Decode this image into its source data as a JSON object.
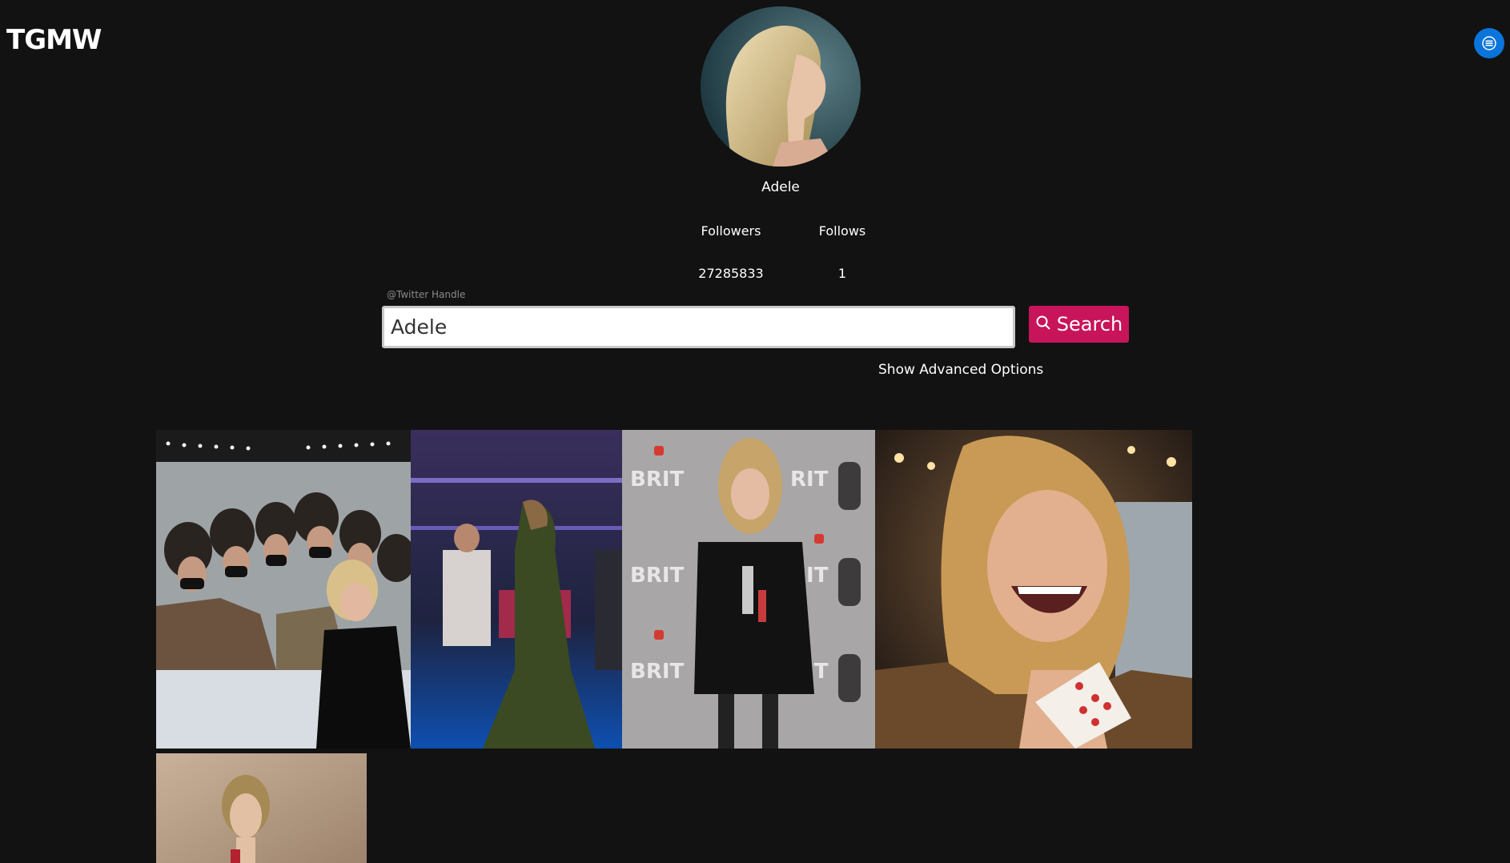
{
  "brand": {
    "title": "TGMW"
  },
  "menu": {
    "icon": "menu-icon",
    "color": "#0a74da"
  },
  "profile": {
    "name": "Adele",
    "followers_label": "Followers",
    "followers_value": "27285833",
    "follows_label": "Follows",
    "follows_value": "1"
  },
  "search": {
    "label": "@Twitter Handle",
    "value": "Adele",
    "button_label": "Search",
    "button_icon": "search-icon",
    "button_color": "#c8145a",
    "advanced_label": "Show Advanced Options"
  },
  "gallery": {
    "photos": [
      {
        "name": "group-selfie-photo"
      },
      {
        "name": "backstage-gown-photo"
      },
      {
        "name": "brit-awards-photo"
      },
      {
        "name": "laughing-cards-photo"
      },
      {
        "name": "portrait-photo"
      }
    ]
  },
  "colors": {
    "background": "#121212",
    "accent": "#c8145a",
    "menu": "#0a74da"
  }
}
